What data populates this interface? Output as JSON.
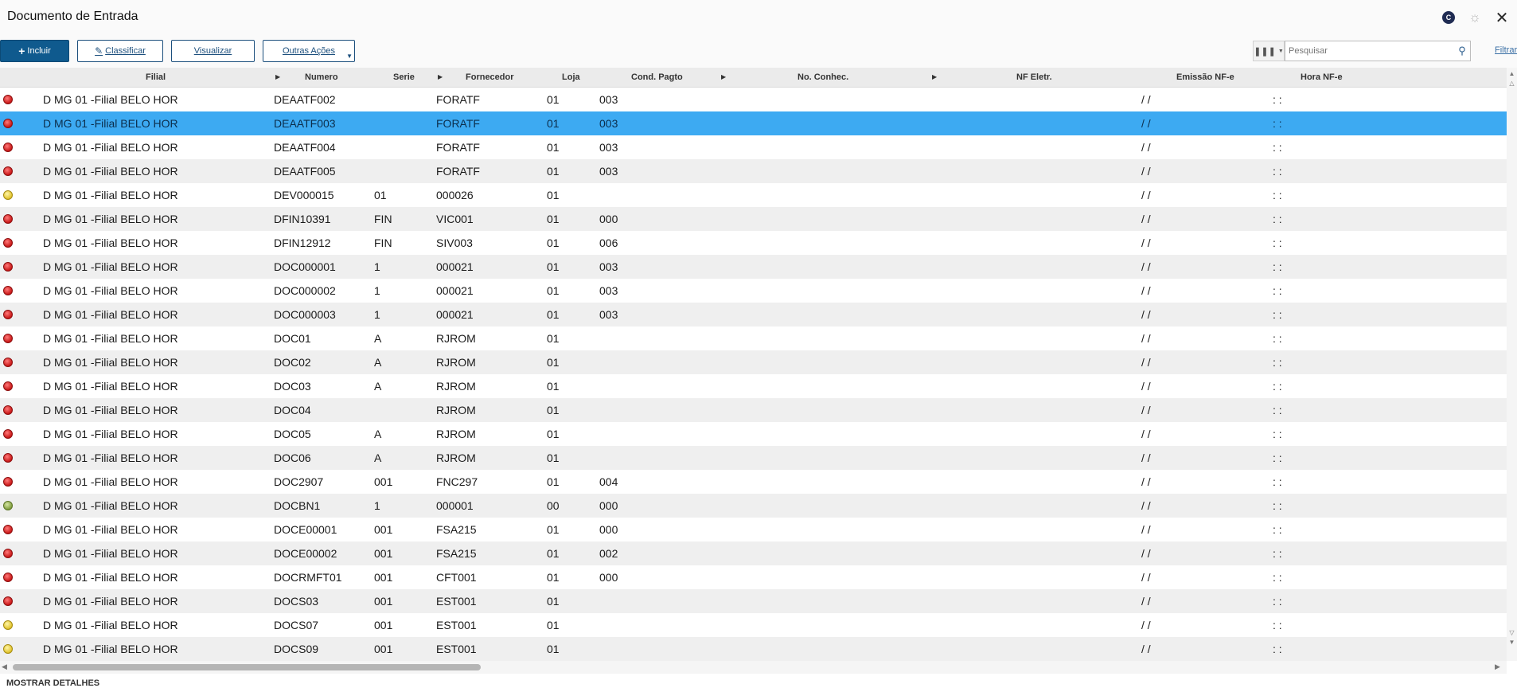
{
  "app": {
    "title": "Documento de Entrada"
  },
  "titlebar_icons": {
    "brand": "brand-circle-icon",
    "brand_glyph": "C",
    "settings": "gear-icon",
    "close": "close-icon"
  },
  "toolbar": {
    "incluir_label": "Incluir",
    "classificar_label": "Classificar",
    "visualizar_label": "Visualizar",
    "outras_label": "Outras Ações"
  },
  "search": {
    "placeholder": "Pesquisar",
    "value": ""
  },
  "filter_link": "Filtrar",
  "columns": {
    "filial": "Filial",
    "numero": "Numero",
    "serie": "Serie",
    "fornecedor": "Fornecedor",
    "loja": "Loja",
    "cond_pagto": "Cond. Pagto",
    "no_conhec": "No. Conhec.",
    "nf_eletr": "NF Eletr.",
    "emissao_nfe": "Emissão NF-e",
    "hora_nfe": "Hora NF-e"
  },
  "colors": {
    "selected_row": "#3daaf2",
    "primary_button": "#0f5a8e",
    "status_red": "#c81616",
    "status_yellow": "#e0c22b",
    "status_green": "#7f9c3d"
  },
  "rows": [
    {
      "status": "red",
      "filial": "D MG 01 -Filial BELO HOR",
      "numero": "DEAATF002",
      "serie": "",
      "fornecedor": "FORATF",
      "loja": "01",
      "cond_pagto": "003",
      "emissao": "/ /",
      "hora": ": :",
      "selected": false
    },
    {
      "status": "red",
      "filial": "D MG 01 -Filial BELO HOR",
      "numero": "DEAATF003",
      "serie": "",
      "fornecedor": "FORATF",
      "loja": "01",
      "cond_pagto": "003",
      "emissao": "/ /",
      "hora": ": :",
      "selected": true
    },
    {
      "status": "red",
      "filial": "D MG 01 -Filial BELO HOR",
      "numero": "DEAATF004",
      "serie": "",
      "fornecedor": "FORATF",
      "loja": "01",
      "cond_pagto": "003",
      "emissao": "/ /",
      "hora": ": :",
      "selected": false
    },
    {
      "status": "red",
      "filial": "D MG 01 -Filial BELO HOR",
      "numero": "DEAATF005",
      "serie": "",
      "fornecedor": "FORATF",
      "loja": "01",
      "cond_pagto": "003",
      "emissao": "/ /",
      "hora": ": :",
      "selected": false
    },
    {
      "status": "yellow",
      "filial": "D MG 01 -Filial BELO HOR",
      "numero": "DEV000015",
      "serie": "01",
      "fornecedor": "000026",
      "loja": "01",
      "cond_pagto": "",
      "emissao": "/ /",
      "hora": ": :",
      "selected": false
    },
    {
      "status": "red",
      "filial": "D MG 01 -Filial BELO HOR",
      "numero": "DFIN10391",
      "serie": "FIN",
      "fornecedor": "VIC001",
      "loja": "01",
      "cond_pagto": "000",
      "emissao": "/ /",
      "hora": ": :",
      "selected": false
    },
    {
      "status": "red",
      "filial": "D MG 01 -Filial BELO HOR",
      "numero": "DFIN12912",
      "serie": "FIN",
      "fornecedor": "SIV003",
      "loja": "01",
      "cond_pagto": "006",
      "emissao": "/ /",
      "hora": ": :",
      "selected": false
    },
    {
      "status": "red",
      "filial": "D MG 01 -Filial BELO HOR",
      "numero": "DOC000001",
      "serie": "1",
      "fornecedor": "000021",
      "loja": "01",
      "cond_pagto": "003",
      "emissao": "/ /",
      "hora": ": :",
      "selected": false
    },
    {
      "status": "red",
      "filial": "D MG 01 -Filial BELO HOR",
      "numero": "DOC000002",
      "serie": "1",
      "fornecedor": "000021",
      "loja": "01",
      "cond_pagto": "003",
      "emissao": "/ /",
      "hora": ": :",
      "selected": false
    },
    {
      "status": "red",
      "filial": "D MG 01 -Filial BELO HOR",
      "numero": "DOC000003",
      "serie": "1",
      "fornecedor": "000021",
      "loja": "01",
      "cond_pagto": "003",
      "emissao": "/ /",
      "hora": ": :",
      "selected": false
    },
    {
      "status": "red",
      "filial": "D MG 01 -Filial BELO HOR",
      "numero": "DOC01",
      "serie": "A",
      "fornecedor": "RJROM",
      "loja": "01",
      "cond_pagto": "",
      "emissao": "/ /",
      "hora": ": :",
      "selected": false
    },
    {
      "status": "red",
      "filial": "D MG 01 -Filial BELO HOR",
      "numero": "DOC02",
      "serie": "A",
      "fornecedor": "RJROM",
      "loja": "01",
      "cond_pagto": "",
      "emissao": "/ /",
      "hora": ": :",
      "selected": false
    },
    {
      "status": "red",
      "filial": "D MG 01 -Filial BELO HOR",
      "numero": "DOC03",
      "serie": "A",
      "fornecedor": "RJROM",
      "loja": "01",
      "cond_pagto": "",
      "emissao": "/ /",
      "hora": ": :",
      "selected": false
    },
    {
      "status": "red",
      "filial": "D MG 01 -Filial BELO HOR",
      "numero": "DOC04",
      "serie": "",
      "fornecedor": "RJROM",
      "loja": "01",
      "cond_pagto": "",
      "emissao": "/ /",
      "hora": ": :",
      "selected": false
    },
    {
      "status": "red",
      "filial": "D MG 01 -Filial BELO HOR",
      "numero": "DOC05",
      "serie": "A",
      "fornecedor": "RJROM",
      "loja": "01",
      "cond_pagto": "",
      "emissao": "/ /",
      "hora": ": :",
      "selected": false
    },
    {
      "status": "red",
      "filial": "D MG 01 -Filial BELO HOR",
      "numero": "DOC06",
      "serie": "A",
      "fornecedor": "RJROM",
      "loja": "01",
      "cond_pagto": "",
      "emissao": "/ /",
      "hora": ": :",
      "selected": false
    },
    {
      "status": "red",
      "filial": "D MG 01 -Filial BELO HOR",
      "numero": "DOC2907",
      "serie": "001",
      "fornecedor": "FNC297",
      "loja": "01",
      "cond_pagto": "004",
      "emissao": "/ /",
      "hora": ": :",
      "selected": false
    },
    {
      "status": "green",
      "filial": "D MG 01 -Filial BELO HOR",
      "numero": "DOCBN1",
      "serie": "1",
      "fornecedor": "000001",
      "loja": "00",
      "cond_pagto": "000",
      "emissao": "/ /",
      "hora": ": :",
      "selected": false
    },
    {
      "status": "red",
      "filial": "D MG 01 -Filial BELO HOR",
      "numero": "DOCE00001",
      "serie": "001",
      "fornecedor": "FSA215",
      "loja": "01",
      "cond_pagto": "000",
      "emissao": "/ /",
      "hora": ": :",
      "selected": false
    },
    {
      "status": "red",
      "filial": "D MG 01 -Filial BELO HOR",
      "numero": "DOCE00002",
      "serie": "001",
      "fornecedor": "FSA215",
      "loja": "01",
      "cond_pagto": "002",
      "emissao": "/ /",
      "hora": ": :",
      "selected": false
    },
    {
      "status": "red",
      "filial": "D MG 01 -Filial BELO HOR",
      "numero": "DOCRMFT01",
      "serie": "001",
      "fornecedor": "CFT001",
      "loja": "01",
      "cond_pagto": "000",
      "emissao": "/ /",
      "hora": ": :",
      "selected": false
    },
    {
      "status": "red",
      "filial": "D MG 01 -Filial BELO HOR",
      "numero": "DOCS03",
      "serie": "001",
      "fornecedor": "EST001",
      "loja": "01",
      "cond_pagto": "",
      "emissao": "/ /",
      "hora": ": :",
      "selected": false
    },
    {
      "status": "yellow",
      "filial": "D MG 01 -Filial BELO HOR",
      "numero": "DOCS07",
      "serie": "001",
      "fornecedor": "EST001",
      "loja": "01",
      "cond_pagto": "",
      "emissao": "/ /",
      "hora": ": :",
      "selected": false
    },
    {
      "status": "yellow",
      "filial": "D MG 01 -Filial BELO HOR",
      "numero": "DOCS09",
      "serie": "001",
      "fornecedor": "EST001",
      "loja": "01",
      "cond_pagto": "",
      "emissao": "/ /",
      "hora": ": :",
      "selected": false
    }
  ],
  "footer": {
    "label": "MOSTRAR DETALHES"
  }
}
